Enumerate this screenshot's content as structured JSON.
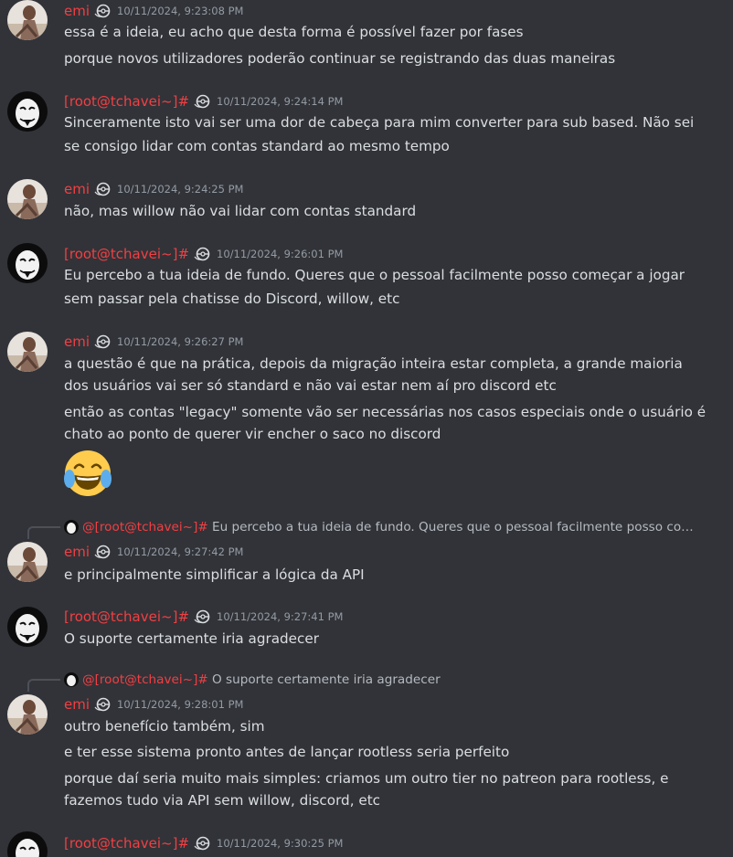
{
  "colors": {
    "background": "#313338",
    "author": "#f23f43",
    "text": "#dbdee1",
    "timestamp": "#949ba4"
  },
  "messages": [
    {
      "author": "emi",
      "timestamp": "10/11/2024, 9:23:08 PM",
      "avatar": "emi-avatar",
      "lines": [
        "essa é a ideia, eu acho que desta forma é possível fazer por fases",
        "porque novos utilizadores poderão continuar se registrando das duas maneiras"
      ]
    },
    {
      "author": "[root@tchavei~]#",
      "timestamp": "10/11/2024, 9:24:14 PM",
      "avatar": "mask-avatar",
      "lines": [
        "Sinceramente isto vai ser uma dor de cabeça para mim converter para sub based. Não sei",
        "se consigo lidar com contas standard ao mesmo tempo"
      ]
    },
    {
      "author": "emi",
      "timestamp": "10/11/2024, 9:24:25 PM",
      "avatar": "emi-avatar",
      "lines": [
        "não, mas willow não vai lidar com contas standard"
      ]
    },
    {
      "author": "[root@tchavei~]#",
      "timestamp": "10/11/2024, 9:26:01 PM",
      "avatar": "mask-avatar",
      "lines": [
        "Eu percebo a tua ideia de fundo. Queres que o pessoal facilmente posso começar a jogar",
        "sem passar pela chatisse do Discord, willow, etc"
      ]
    },
    {
      "author": "emi",
      "timestamp": "10/11/2024, 9:26:27 PM",
      "avatar": "emi-avatar",
      "lines": [
        "a questão é que na prática, depois da migração inteira estar completa, a grande maioria",
        "dos usuários vai ser só standard e não vai estar nem aí pro discord etc",
        "então as contas \"legacy\" somente vão ser necessárias nos casos especiais onde o usuário é",
        "chato ao ponto de querer vir encher o saco no discord"
      ],
      "emoji": "joy-emoji"
    },
    {
      "author": "emi",
      "timestamp": "10/11/2024, 9:27:42 PM",
      "avatar": "emi-avatar",
      "reply": {
        "name": "@[root@tchavei~]#",
        "preview": "Eu percebo a tua ideia de fundo. Queres que o pessoal facilmente posso começ..."
      },
      "lines": [
        "e principalmente simplificar a lógica da API"
      ]
    },
    {
      "author": "[root@tchavei~]#",
      "timestamp": "10/11/2024, 9:27:41 PM",
      "avatar": "mask-avatar",
      "lines": [
        "O suporte certamente iria agradecer"
      ]
    },
    {
      "author": "emi",
      "timestamp": "10/11/2024, 9:28:01 PM",
      "avatar": "emi-avatar",
      "reply": {
        "name": "@[root@tchavei~]#",
        "preview": "O suporte certamente iria agradecer"
      },
      "lines": [
        "outro benefício também, sim",
        "e ter esse sistema pronto antes de lançar rootless seria perfeito",
        "porque daí seria muito mais simples: criamos um outro tier no patreon para rootless, e",
        "fazemos tudo via API sem willow, discord, etc"
      ]
    },
    {
      "author": "[root@tchavei~]#",
      "timestamp": "10/11/2024, 9:30:25 PM",
      "avatar": "mask-avatar",
      "lines": []
    }
  ]
}
